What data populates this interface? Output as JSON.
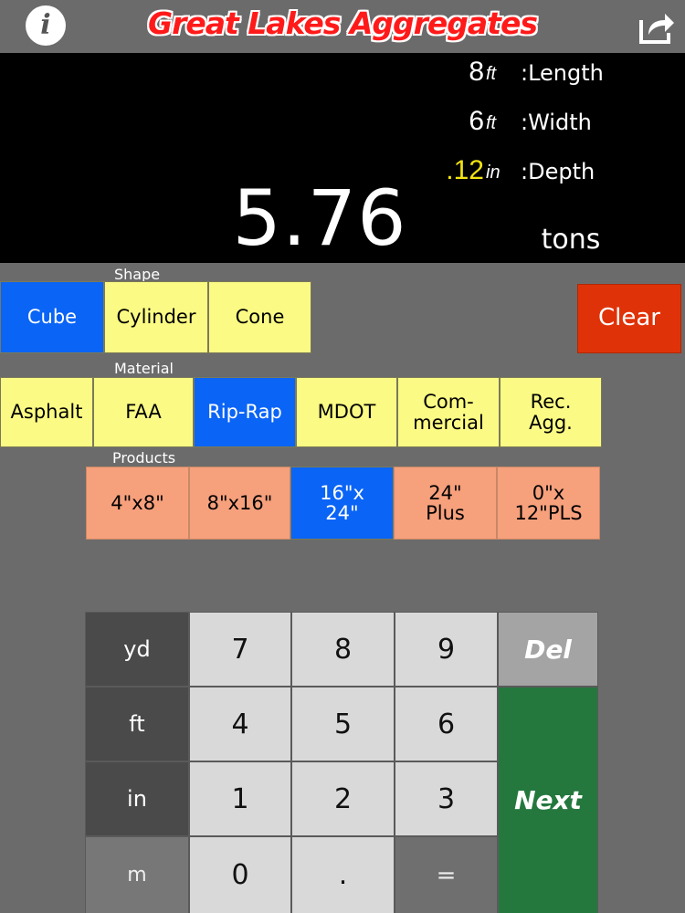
{
  "header": {
    "title": "Great Lakes Aggregates",
    "info_icon": "i"
  },
  "display": {
    "dimensions": [
      {
        "value": "8",
        "unit": "ft",
        "label": ":Length",
        "value_color": "#ffffff"
      },
      {
        "value": "6",
        "unit": "ft",
        "label": ":Width",
        "value_color": "#ffffff"
      },
      {
        "value": ".12",
        "unit": "in",
        "label": ":Depth",
        "value_color": "#f2e312"
      }
    ],
    "result": "5.76",
    "result_unit": "tons"
  },
  "shape": {
    "label": "Shape",
    "options": [
      "Cube",
      "Cylinder",
      "Cone"
    ],
    "selected": "Cube",
    "clear_label": "Clear"
  },
  "material": {
    "label": "Material",
    "options": [
      "Asphalt",
      "FAA",
      "Rip-Rap",
      "MDOT",
      "Com-\nmercial",
      "Rec.\nAgg."
    ],
    "selected": "Rip-Rap"
  },
  "products": {
    "label": "Products",
    "options": [
      "4\"x8\"",
      "8\"x16\"",
      "16\"x\n24\"",
      "24\"\nPlus",
      "0\"x\n12\"PLS"
    ],
    "selected": "16\"x\n24\""
  },
  "keypad": {
    "units": [
      "yd",
      "ft",
      "in",
      "m"
    ],
    "digits": [
      "7",
      "8",
      "9",
      "4",
      "5",
      "6",
      "1",
      "2",
      "3",
      "0",
      ".",
      "="
    ],
    "del_label": "Del",
    "next_label": "Next"
  },
  "colors": {
    "background": "#6b6b6b",
    "selected": "#0a64f6",
    "option": "#fbfa84",
    "product": "#f6a07c",
    "clear": "#e03208",
    "next": "#24783e"
  }
}
